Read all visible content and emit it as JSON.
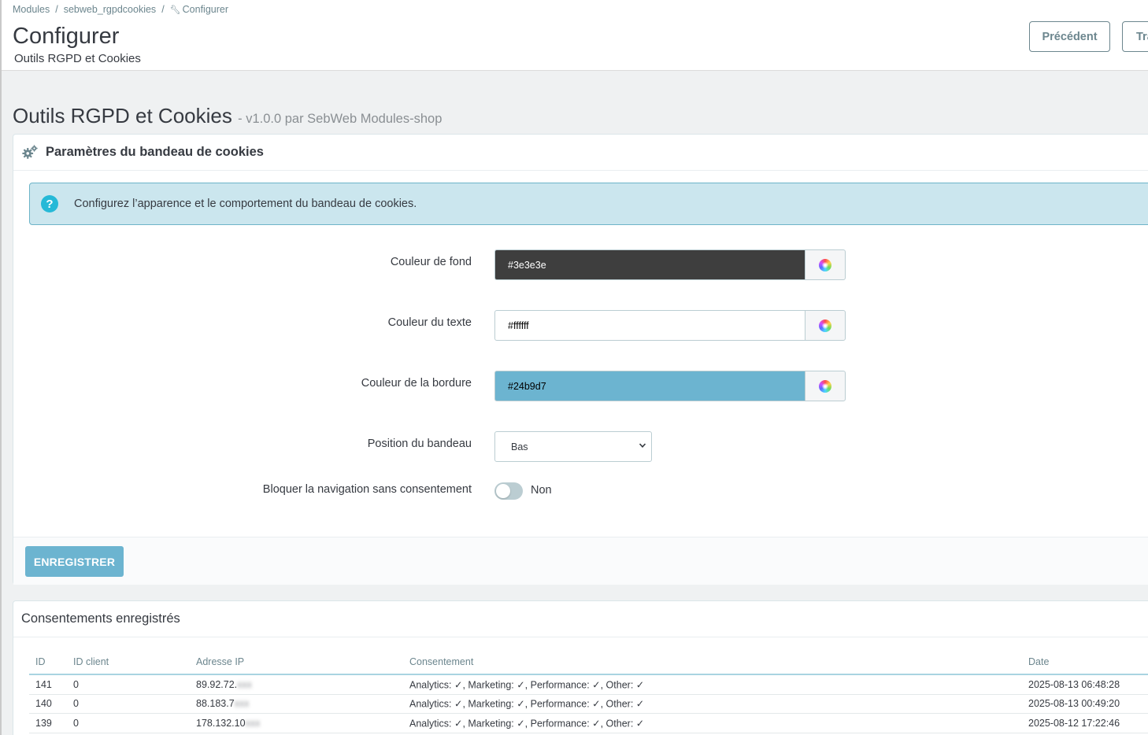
{
  "breadcrumb": {
    "items": [
      "Modules",
      "sebweb_rgpdcookies"
    ],
    "current": "Configurer"
  },
  "header": {
    "title": "Configurer",
    "subtitle": "Outils RGPD et Cookies",
    "prev_button": "Précédent",
    "next_button": "Traduire"
  },
  "module": {
    "title": "Outils RGPD et Cookies",
    "meta": "- v1.0.0 par SebWeb Modules-shop"
  },
  "settings_panel": {
    "heading": "Paramètres du bandeau de cookies",
    "alert": "Configurez l’apparence et le comportement du bandeau de cookies.",
    "fields": {
      "bg_color": {
        "label": "Couleur de fond",
        "value": "#3e3e3e",
        "swatch": "#3e3e3e",
        "text_color": "#ffffff"
      },
      "text_color": {
        "label": "Couleur du texte",
        "value": "#ffffff",
        "swatch": "#ffffff",
        "text_color": "#000000"
      },
      "border_color": {
        "label": "Couleur de la bordure",
        "value": "#24b9d7",
        "swatch": "#6cb4d0",
        "text_color": "#000000"
      },
      "position": {
        "label": "Position du bandeau",
        "value": "Bas"
      },
      "block_nav": {
        "label": "Bloquer la navigation sans consentement",
        "value": "Non",
        "enabled": false
      }
    },
    "save_button": "ENREGISTRER"
  },
  "consents_panel": {
    "heading": "Consentements enregistrés",
    "columns": [
      "ID",
      "ID client",
      "Adresse IP",
      "Consentement",
      "Date"
    ],
    "rows": [
      {
        "id": "141",
        "client": "0",
        "ip": "89.92.72.",
        "ip_masked": "xxx",
        "consent": "Analytics: ✓, Marketing: ✓, Performance: ✓, Other: ✓",
        "date": "2025-08-13 06:48:28"
      },
      {
        "id": "140",
        "client": "0",
        "ip": "88.183.7",
        "ip_masked": "xxx",
        "consent": "Analytics: ✓, Marketing: ✓, Performance: ✓, Other: ✓",
        "date": "2025-08-13 00:49:20"
      },
      {
        "id": "139",
        "client": "0",
        "ip": "178.132.10",
        "ip_masked": "xxx",
        "consent": "Analytics: ✓, Marketing: ✓, Performance: ✓, Other: ✓",
        "date": "2025-08-12 17:22:46"
      }
    ]
  },
  "colors": {
    "accent": "#25b9d7",
    "save_button": "#6cb4d0",
    "alert_bg": "#cbe6ee"
  },
  "icons": [
    "gears-icon",
    "help-icon",
    "color-wheel-icon",
    "chevron-down-icon",
    "wrench-icon"
  ]
}
